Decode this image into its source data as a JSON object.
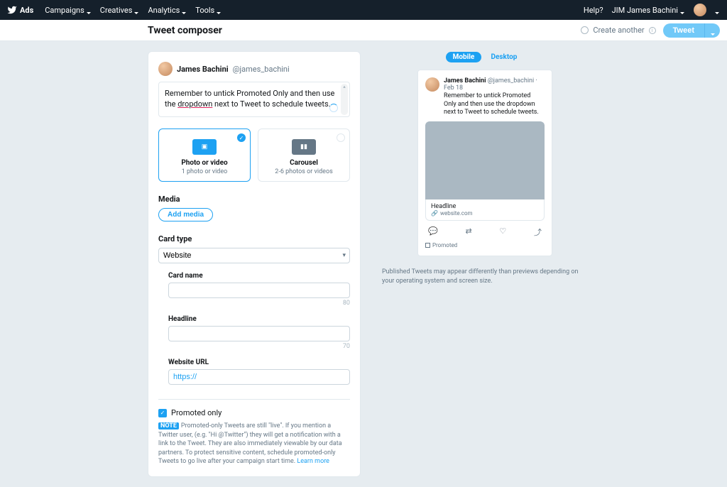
{
  "nav": {
    "brand": "Ads",
    "items": [
      "Campaigns",
      "Creatives",
      "Analytics",
      "Tools"
    ],
    "help": "Help?",
    "account": "JIM James Bachini"
  },
  "subbar": {
    "title": "Tweet composer",
    "create_another": "Create another",
    "tweet": "Tweet"
  },
  "composer": {
    "author_name": "James Bachini",
    "author_handle": "@james_bachini",
    "text_pre": "Remember to untick Promoted Only and then use the ",
    "text_underlined": "dropdown",
    "text_post": " next to Tweet to schedule tweets."
  },
  "types": {
    "photo": {
      "title": "Photo or video",
      "sub": "1 photo or video"
    },
    "carousel": {
      "title": "Carousel",
      "sub": "2-6 photos or videos"
    }
  },
  "media": {
    "label": "Media",
    "btn": "Add media"
  },
  "card": {
    "label": "Card type",
    "selected": "Website",
    "fields": {
      "card_name": {
        "label": "Card name",
        "counter": "80"
      },
      "headline": {
        "label": "Headline",
        "counter": "70"
      },
      "url": {
        "label": "Website URL",
        "placeholder": "https://"
      }
    }
  },
  "promo": {
    "label": "Promoted only",
    "note_tag": "NOTE",
    "note_text": "Promoted-only Tweets are still \"live\". If you mention a Twitter user, (e.g. \"Hi @Twitter\") they will get a notification with a link to the Tweet. They are also immediately viewable by our data partners. To protect sensitive content, schedule promoted-only Tweets to go live after your campaign start time.",
    "learn_more": "Learn more"
  },
  "preview": {
    "tabs": {
      "mobile": "Mobile",
      "desktop": "Desktop"
    },
    "name": "James Bachini",
    "handle": "@james_bachini",
    "date": "Feb 18",
    "body": "Remember to untick Promoted Only and then use the dropdown next to Tweet to schedule tweets.",
    "headline": "Headline",
    "link_icon": "🔗",
    "link": "website.com",
    "promoted": "Promoted",
    "disclaimer": "Published Tweets may appear differently than previews depending on your operating system and screen size."
  }
}
